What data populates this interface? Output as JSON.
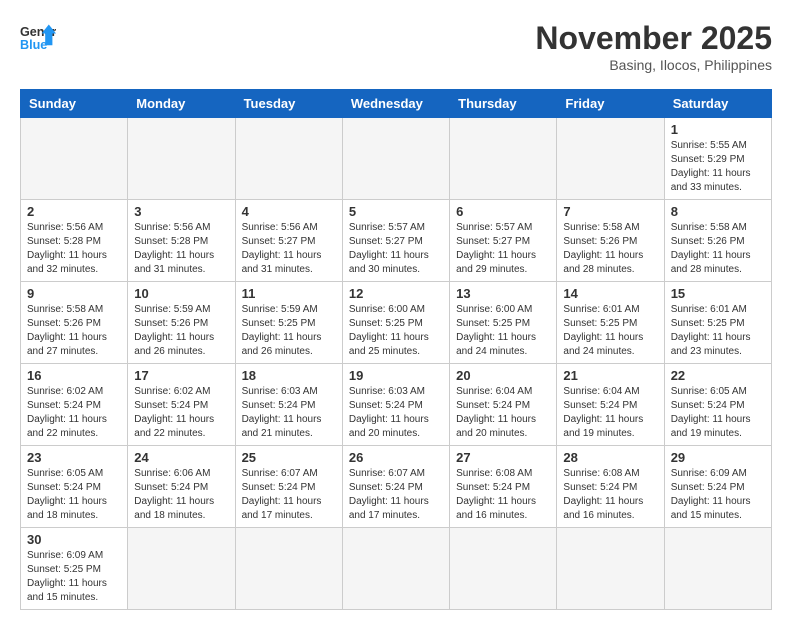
{
  "logo": {
    "general": "General",
    "blue": "Blue"
  },
  "title": "November 2025",
  "location": "Basing, Ilocos, Philippines",
  "weekdays": [
    "Sunday",
    "Monday",
    "Tuesday",
    "Wednesday",
    "Thursday",
    "Friday",
    "Saturday"
  ],
  "weeks": [
    [
      {
        "day": "",
        "info": ""
      },
      {
        "day": "",
        "info": ""
      },
      {
        "day": "",
        "info": ""
      },
      {
        "day": "",
        "info": ""
      },
      {
        "day": "",
        "info": ""
      },
      {
        "day": "",
        "info": ""
      },
      {
        "day": "1",
        "info": "Sunrise: 5:55 AM\nSunset: 5:29 PM\nDaylight: 11 hours\nand 33 minutes."
      }
    ],
    [
      {
        "day": "2",
        "info": "Sunrise: 5:56 AM\nSunset: 5:28 PM\nDaylight: 11 hours\nand 32 minutes."
      },
      {
        "day": "3",
        "info": "Sunrise: 5:56 AM\nSunset: 5:28 PM\nDaylight: 11 hours\nand 31 minutes."
      },
      {
        "day": "4",
        "info": "Sunrise: 5:56 AM\nSunset: 5:27 PM\nDaylight: 11 hours\nand 31 minutes."
      },
      {
        "day": "5",
        "info": "Sunrise: 5:57 AM\nSunset: 5:27 PM\nDaylight: 11 hours\nand 30 minutes."
      },
      {
        "day": "6",
        "info": "Sunrise: 5:57 AM\nSunset: 5:27 PM\nDaylight: 11 hours\nand 29 minutes."
      },
      {
        "day": "7",
        "info": "Sunrise: 5:58 AM\nSunset: 5:26 PM\nDaylight: 11 hours\nand 28 minutes."
      },
      {
        "day": "8",
        "info": "Sunrise: 5:58 AM\nSunset: 5:26 PM\nDaylight: 11 hours\nand 28 minutes."
      }
    ],
    [
      {
        "day": "9",
        "info": "Sunrise: 5:58 AM\nSunset: 5:26 PM\nDaylight: 11 hours\nand 27 minutes."
      },
      {
        "day": "10",
        "info": "Sunrise: 5:59 AM\nSunset: 5:26 PM\nDaylight: 11 hours\nand 26 minutes."
      },
      {
        "day": "11",
        "info": "Sunrise: 5:59 AM\nSunset: 5:25 PM\nDaylight: 11 hours\nand 26 minutes."
      },
      {
        "day": "12",
        "info": "Sunrise: 6:00 AM\nSunset: 5:25 PM\nDaylight: 11 hours\nand 25 minutes."
      },
      {
        "day": "13",
        "info": "Sunrise: 6:00 AM\nSunset: 5:25 PM\nDaylight: 11 hours\nand 24 minutes."
      },
      {
        "day": "14",
        "info": "Sunrise: 6:01 AM\nSunset: 5:25 PM\nDaylight: 11 hours\nand 24 minutes."
      },
      {
        "day": "15",
        "info": "Sunrise: 6:01 AM\nSunset: 5:25 PM\nDaylight: 11 hours\nand 23 minutes."
      }
    ],
    [
      {
        "day": "16",
        "info": "Sunrise: 6:02 AM\nSunset: 5:24 PM\nDaylight: 11 hours\nand 22 minutes."
      },
      {
        "day": "17",
        "info": "Sunrise: 6:02 AM\nSunset: 5:24 PM\nDaylight: 11 hours\nand 22 minutes."
      },
      {
        "day": "18",
        "info": "Sunrise: 6:03 AM\nSunset: 5:24 PM\nDaylight: 11 hours\nand 21 minutes."
      },
      {
        "day": "19",
        "info": "Sunrise: 6:03 AM\nSunset: 5:24 PM\nDaylight: 11 hours\nand 20 minutes."
      },
      {
        "day": "20",
        "info": "Sunrise: 6:04 AM\nSunset: 5:24 PM\nDaylight: 11 hours\nand 20 minutes."
      },
      {
        "day": "21",
        "info": "Sunrise: 6:04 AM\nSunset: 5:24 PM\nDaylight: 11 hours\nand 19 minutes."
      },
      {
        "day": "22",
        "info": "Sunrise: 6:05 AM\nSunset: 5:24 PM\nDaylight: 11 hours\nand 19 minutes."
      }
    ],
    [
      {
        "day": "23",
        "info": "Sunrise: 6:05 AM\nSunset: 5:24 PM\nDaylight: 11 hours\nand 18 minutes."
      },
      {
        "day": "24",
        "info": "Sunrise: 6:06 AM\nSunset: 5:24 PM\nDaylight: 11 hours\nand 18 minutes."
      },
      {
        "day": "25",
        "info": "Sunrise: 6:07 AM\nSunset: 5:24 PM\nDaylight: 11 hours\nand 17 minutes."
      },
      {
        "day": "26",
        "info": "Sunrise: 6:07 AM\nSunset: 5:24 PM\nDaylight: 11 hours\nand 17 minutes."
      },
      {
        "day": "27",
        "info": "Sunrise: 6:08 AM\nSunset: 5:24 PM\nDaylight: 11 hours\nand 16 minutes."
      },
      {
        "day": "28",
        "info": "Sunrise: 6:08 AM\nSunset: 5:24 PM\nDaylight: 11 hours\nand 16 minutes."
      },
      {
        "day": "29",
        "info": "Sunrise: 6:09 AM\nSunset: 5:24 PM\nDaylight: 11 hours\nand 15 minutes."
      }
    ],
    [
      {
        "day": "30",
        "info": "Sunrise: 6:09 AM\nSunset: 5:25 PM\nDaylight: 11 hours\nand 15 minutes."
      },
      {
        "day": "",
        "info": ""
      },
      {
        "day": "",
        "info": ""
      },
      {
        "day": "",
        "info": ""
      },
      {
        "day": "",
        "info": ""
      },
      {
        "day": "",
        "info": ""
      },
      {
        "day": "",
        "info": ""
      }
    ]
  ]
}
